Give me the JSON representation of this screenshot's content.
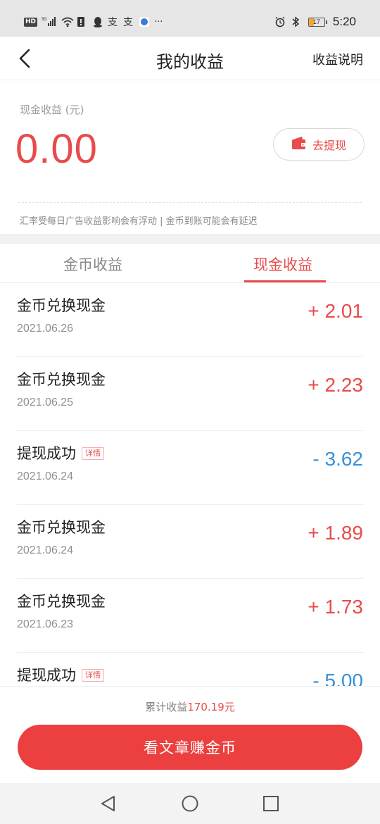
{
  "status_bar": {
    "hd": "HD",
    "network": "5G",
    "time": "5:20",
    "battery": "17",
    "more": "···"
  },
  "nav": {
    "title": "我的收益",
    "action": "收益说明"
  },
  "earnings": {
    "label": "现金收益 (元)",
    "amount": "0.00",
    "withdraw_label": "去提现",
    "note": "汇率受每日广告收益影响会有浮动 | 金币到账可能会有延迟"
  },
  "tabs": [
    {
      "label": "金币收益",
      "active": false
    },
    {
      "label": "现金收益",
      "active": true
    }
  ],
  "records": [
    {
      "title": "金币兑换现金",
      "date": "2021.06.26",
      "amount": "+ 2.01",
      "type": "pos",
      "badge": ""
    },
    {
      "title": "金币兑换现金",
      "date": "2021.06.25",
      "amount": "+ 2.23",
      "type": "pos",
      "badge": ""
    },
    {
      "title": "提现成功",
      "date": "2021.06.24",
      "amount": "- 3.62",
      "type": "neg",
      "badge": "详情"
    },
    {
      "title": "金币兑换现金",
      "date": "2021.06.24",
      "amount": "+ 1.89",
      "type": "pos",
      "badge": ""
    },
    {
      "title": "金币兑换现金",
      "date": "2021.06.23",
      "amount": "+ 1.73",
      "type": "pos",
      "badge": ""
    },
    {
      "title": "提现成功",
      "date": "",
      "amount": "- 5.00",
      "type": "neg",
      "badge": "详情"
    }
  ],
  "footer": {
    "total_label": "累计收益",
    "total_value": "170.19元",
    "cta": "看文章赚金币"
  },
  "colors": {
    "accent": "#e84b4b",
    "negative": "#3a90d6",
    "cta": "#ec3f3f"
  },
  "icons": [
    "back-icon",
    "wallet-icon",
    "alarm-icon",
    "bluetooth-icon",
    "wifi-icon",
    "signal-icon"
  ]
}
